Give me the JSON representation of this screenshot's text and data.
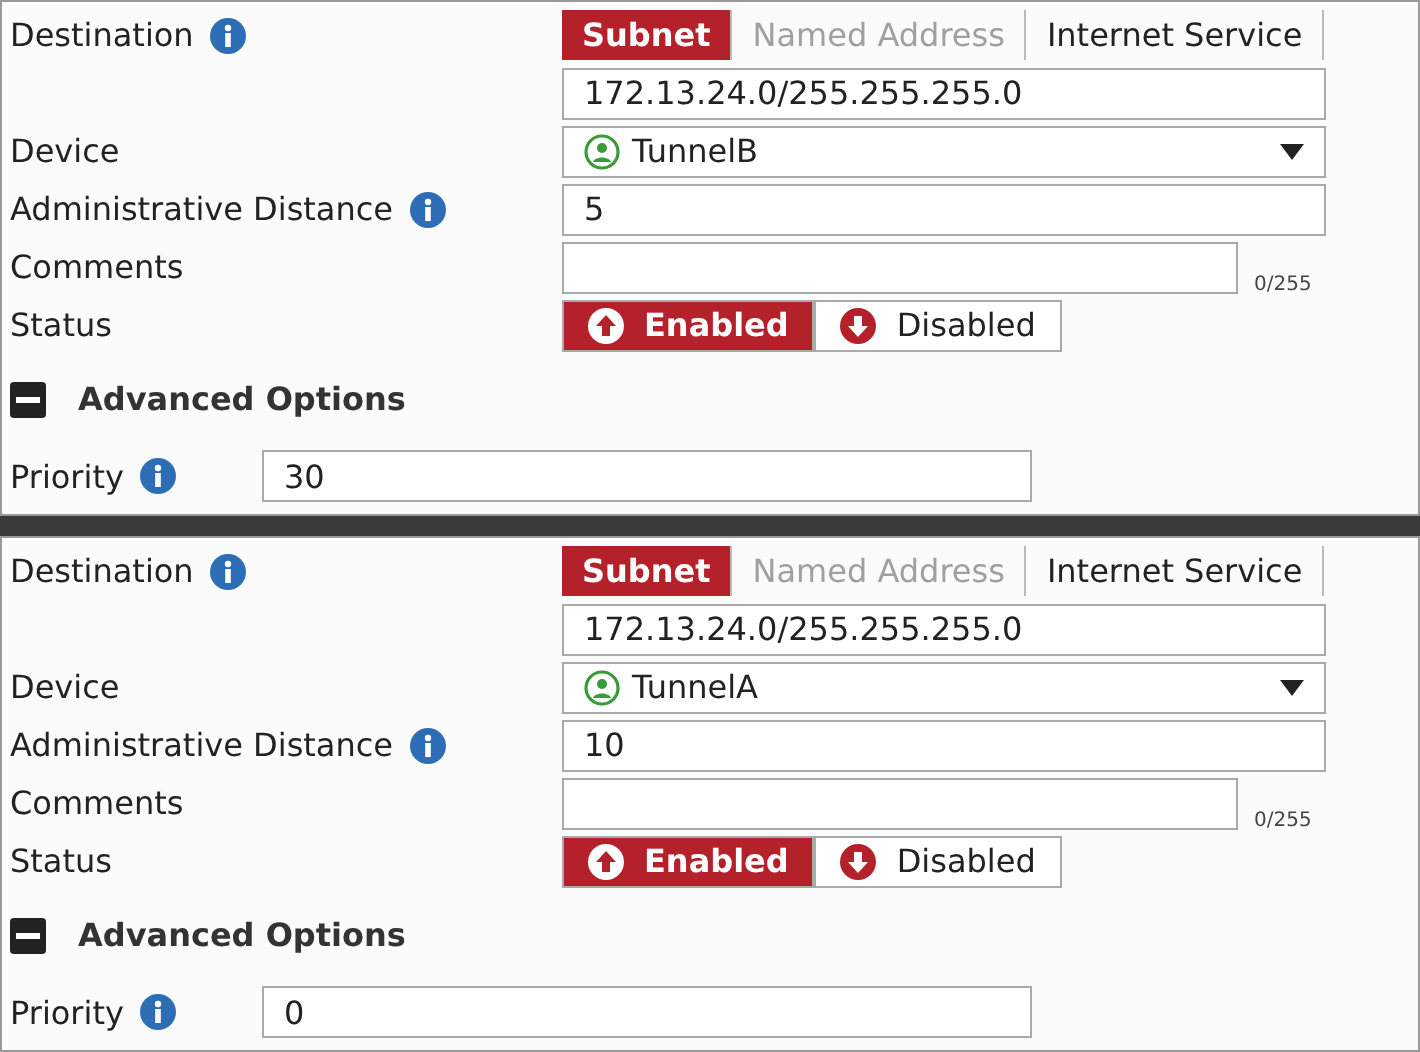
{
  "panels": [
    {
      "destination": {
        "label": "Destination",
        "tabs": [
          {
            "label": "Subnet",
            "selected": true,
            "disabled": false
          },
          {
            "label": "Named Address",
            "selected": false,
            "disabled": true
          },
          {
            "label": "Internet Service",
            "selected": false,
            "disabled": false
          }
        ],
        "value": "172.13.24.0/255.255.255.0"
      },
      "device": {
        "label": "Device",
        "value": "TunnelB"
      },
      "distance": {
        "label": "Administrative Distance",
        "value": "5"
      },
      "comments": {
        "label": "Comments",
        "counter": "0/255"
      },
      "status": {
        "label": "Status",
        "options": [
          {
            "label": "Enabled",
            "kind": "enable",
            "selected": true
          },
          {
            "label": "Disabled",
            "kind": "disable",
            "selected": false
          }
        ]
      },
      "advanced": {
        "label": "Advanced Options",
        "expanded": true
      },
      "priority": {
        "label": "Priority",
        "value": "30"
      }
    },
    {
      "destination": {
        "label": "Destination",
        "tabs": [
          {
            "label": "Subnet",
            "selected": true,
            "disabled": false
          },
          {
            "label": "Named Address",
            "selected": false,
            "disabled": true
          },
          {
            "label": "Internet Service",
            "selected": false,
            "disabled": false
          }
        ],
        "value": "172.13.24.0/255.255.255.0"
      },
      "device": {
        "label": "Device",
        "value": "TunnelA"
      },
      "distance": {
        "label": "Administrative Distance",
        "value": "10"
      },
      "comments": {
        "label": "Comments",
        "counter": "0/255"
      },
      "status": {
        "label": "Status",
        "options": [
          {
            "label": "Enabled",
            "kind": "enable",
            "selected": true
          },
          {
            "label": "Disabled",
            "kind": "disable",
            "selected": false
          }
        ]
      },
      "advanced": {
        "label": "Advanced Options",
        "expanded": true
      },
      "priority": {
        "label": "Priority",
        "value": "0"
      }
    }
  ]
}
